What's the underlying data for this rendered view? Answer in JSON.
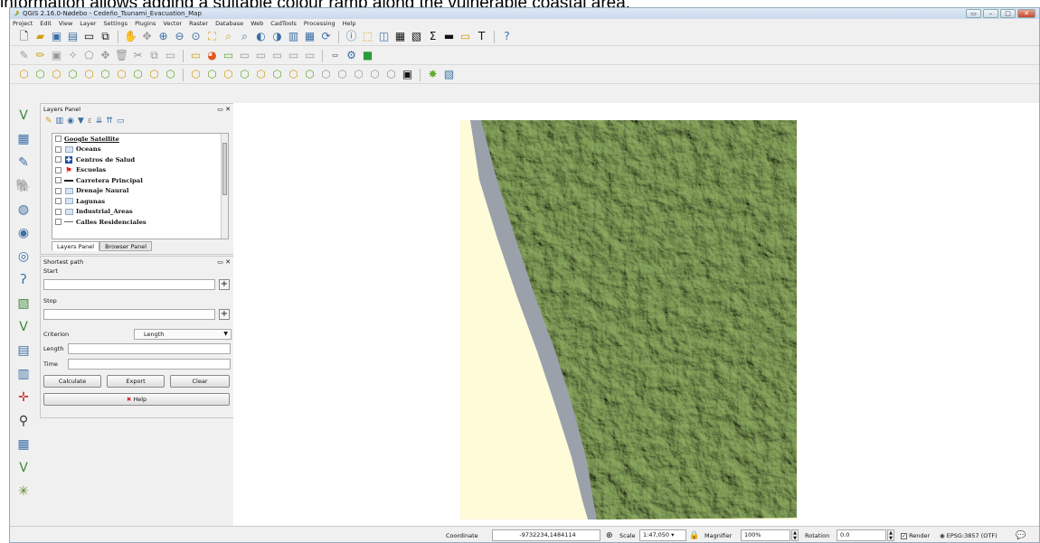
{
  "caption": "information allows adding a suitable colour ramp along the vulnerable coastal area.",
  "window": {
    "title": "QGIS 2.16.0-Nødebo - Cedeño_Tsunami_Evacuation_Map"
  },
  "menu": [
    "Project",
    "Edit",
    "View",
    "Layer",
    "Settings",
    "Plugins",
    "Vector",
    "Raster",
    "Database",
    "Web",
    "CadTools",
    "Processing",
    "Help"
  ],
  "layers_panel": {
    "title": "Layers Panel",
    "layers": [
      {
        "name": "Google Satellite",
        "symbol": "none"
      },
      {
        "name": "Oceans",
        "symbol": "fill-lightblue"
      },
      {
        "name": "Centros de Salud",
        "symbol": "health-cross"
      },
      {
        "name": "Escuelas",
        "symbol": "school-flag"
      },
      {
        "name": "Carretera Principal",
        "symbol": "line-dark"
      },
      {
        "name": "Drenaje Naural",
        "symbol": "fill-lightblue"
      },
      {
        "name": "Lagunas",
        "symbol": "fill-lightblue"
      },
      {
        "name": "Industrial_Areas",
        "symbol": "fill-lightblue"
      },
      {
        "name": "Calles Residenciales",
        "symbol": "line-gray"
      }
    ],
    "tabs": [
      "Layers Panel",
      "Browser Panel"
    ]
  },
  "shortest_path": {
    "title": "Shortest path",
    "start_label": "Start",
    "stop_label": "Stop",
    "criterion_label": "Criterion",
    "criterion_value": "Length",
    "length_label": "Length",
    "time_label": "Time",
    "calculate": "Calculate",
    "export": "Export",
    "clear": "Clear",
    "help": "Help"
  },
  "statusbar": {
    "coordinate_label": "Coordinate",
    "coordinate_value": "-9732234,1484114",
    "scale_label": "Scale",
    "scale_value": "1:47,050",
    "magnifier_label": "Magnifier",
    "magnifier_value": "100%",
    "rotation_label": "Rotation",
    "rotation_value": "0.0",
    "render_label": "Render",
    "crs": "EPSG:3857 (OTF)"
  },
  "colors": {
    "terrain": "#5f7f3e",
    "ocean": "#fdfbd8",
    "coast": "#9aa1ab"
  }
}
